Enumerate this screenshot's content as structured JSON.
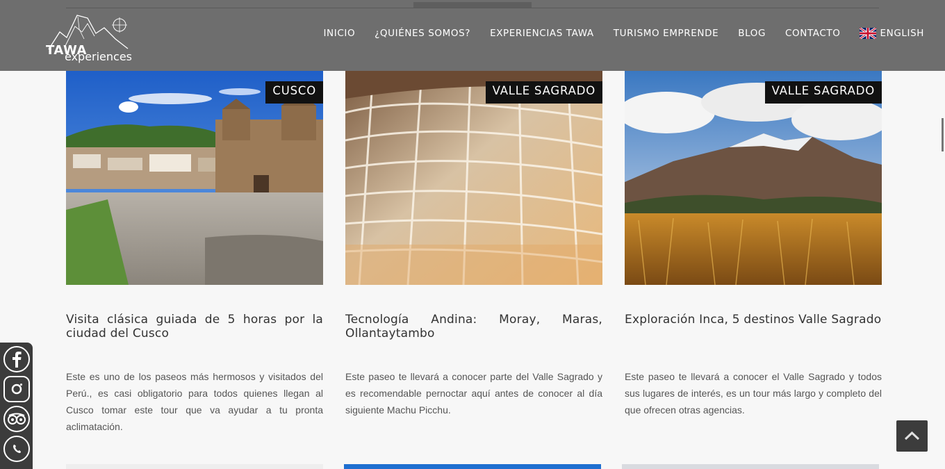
{
  "header": {
    "logo": {
      "brand": "TAWA",
      "sub": "experiences"
    },
    "nav": [
      {
        "label": "INICIO"
      },
      {
        "label": "¿QUIÉNES SOMOS?"
      },
      {
        "label": "EXPERIENCIAS TAWA"
      },
      {
        "label": "TURISMO EMPRENDE"
      },
      {
        "label": "BLOG"
      },
      {
        "label": "CONTACTO"
      }
    ],
    "language": {
      "label": "ENGLISH",
      "icon": "uk-flag-icon"
    }
  },
  "cards": [
    {
      "badge": "CUSCO",
      "title": "Visita clásica guiada de 5 horas por la ciudad del Cusco",
      "description": "Este es uno de los paseos más hermosos y visitados del Perú., es casi obligatorio para todos quienes llegan al Cusco tomar este tour que va ayudar a tu pronta aclimatación."
    },
    {
      "badge": "VALLE SAGRADO",
      "title": "Tecnología Andina: Moray, Maras, Ollantaytambo",
      "description": "Este paseo te llevará a conocer parte del Valle Sagrado y es recomendable pernoctar aquí antes de conocer al día siguiente Machu Picchu."
    },
    {
      "badge": "VALLE SAGRADO",
      "title": "Exploración Inca, 5 destinos Valle Sagrado",
      "description": "Este paseo te llevará a conocer el Valle Sagrado y todos sus lugares de interés, es un tour más largo y completo del que ofrecen otras agencias."
    }
  ],
  "social": [
    {
      "icon": "facebook-icon"
    },
    {
      "icon": "instagram-icon"
    },
    {
      "icon": "tripadvisor-icon"
    },
    {
      "icon": "whatsapp-icon"
    }
  ],
  "scroll_top": {
    "icon": "chevron-up-icon"
  },
  "colors": {
    "header_bg": "#6e6e6e",
    "badge_bg": "#111111",
    "sidebar_bg": "#3c3c3c"
  }
}
